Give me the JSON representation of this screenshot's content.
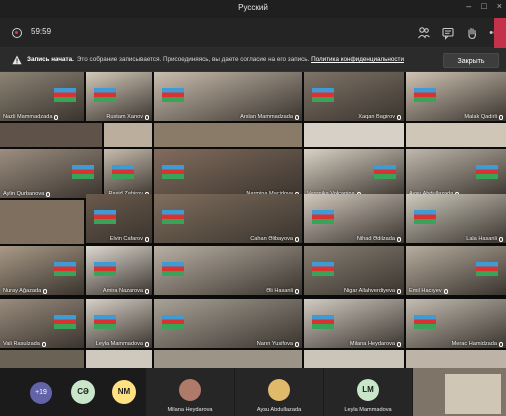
{
  "window": {
    "title": "Русский"
  },
  "toolbar": {
    "timer": "59:59",
    "icons": [
      "record-icon",
      "participants-icon",
      "chat-icon",
      "raise-hand-icon",
      "more-options-icon"
    ]
  },
  "banner": {
    "bold": "Запись начата.",
    "message": "Это собрание записывается. Присоединяясь, вы даете согласие на его запись.",
    "link": "Политика конфиденциальности",
    "button": "Закрыть"
  },
  "gallery": {
    "tiles": [
      {
        "name": "Nazli Mammadzada",
        "bg": "#8d8476"
      },
      {
        "name": "Rustam Xanov",
        "bg": "#d3c9ba"
      },
      {
        "name": "Arslan Mammadzada",
        "bg": "#c9bdae"
      },
      {
        "name": "Xaqan Bagirov",
        "bg": "#7e7367"
      },
      {
        "name": "Malak Qadirli",
        "bg": "#cfc3b4"
      },
      {
        "name": "Aylin Qurbanova",
        "bg": "#9c8e80"
      },
      {
        "name": "Raşid Zahirov",
        "bg": "#c7bcae"
      },
      {
        "name": "Narmina Macidova",
        "bg": "#826c5d"
      },
      {
        "name": "Veronika Volçanina",
        "bg": "#d9d2c5"
      },
      {
        "name": "Aysu Abdullazada",
        "bg": "#c0b8ad"
      },
      {
        "name": "Elvin Cafarov",
        "bg": "#6a5a4c"
      },
      {
        "name": "Cahan Əlibayova",
        "bg": "#7f6e5d"
      },
      {
        "name": "Nihad Ədilzada",
        "bg": "#d2c8bd"
      },
      {
        "name": "Lala Hasanli",
        "bg": "#cdcabd"
      },
      {
        "name": "Nuray Ağazada",
        "bg": "#a99a87"
      },
      {
        "name": "Amira Nazarova",
        "bg": "#ddd8cf"
      },
      {
        "name": "Əli Hasanli",
        "bg": "#b9b0a4"
      },
      {
        "name": "Nigar Allahverdiyeva",
        "bg": "#877f73"
      },
      {
        "name": "Emil Hacıyev",
        "bg": "#b7ad9f"
      },
      {
        "name": "Vali Rasulzada",
        "bg": "#9a8c7e"
      },
      {
        "name": "Leyla Mammadova",
        "bg": "#d6d0c7"
      },
      {
        "name": "Narın Yusifova",
        "bg": "#a9a297"
      },
      {
        "name": "Milana Heydarova",
        "bg": "#d1cbc2"
      },
      {
        "name": "Merac Hamidzada",
        "bg": "#c4bdb2"
      }
    ]
  },
  "strip": {
    "more_count": "+19",
    "avatars": [
      {
        "initials": "CƏ",
        "color": "#c8e6c9"
      },
      {
        "initials": "NM",
        "color": "#ffe082"
      }
    ],
    "tiles": [
      {
        "name": "Milana Heydarova",
        "color": "#b07a6a"
      },
      {
        "name": "Aysu Abdullazada",
        "color": "#e0b96b"
      },
      {
        "name": "Leyla Mammadova",
        "initials": "LM",
        "color": "#c8e6c9"
      }
    ]
  },
  "colors": {
    "accent": "#6264a7",
    "leave": "#c4314b",
    "warning": "#f2c14e"
  }
}
